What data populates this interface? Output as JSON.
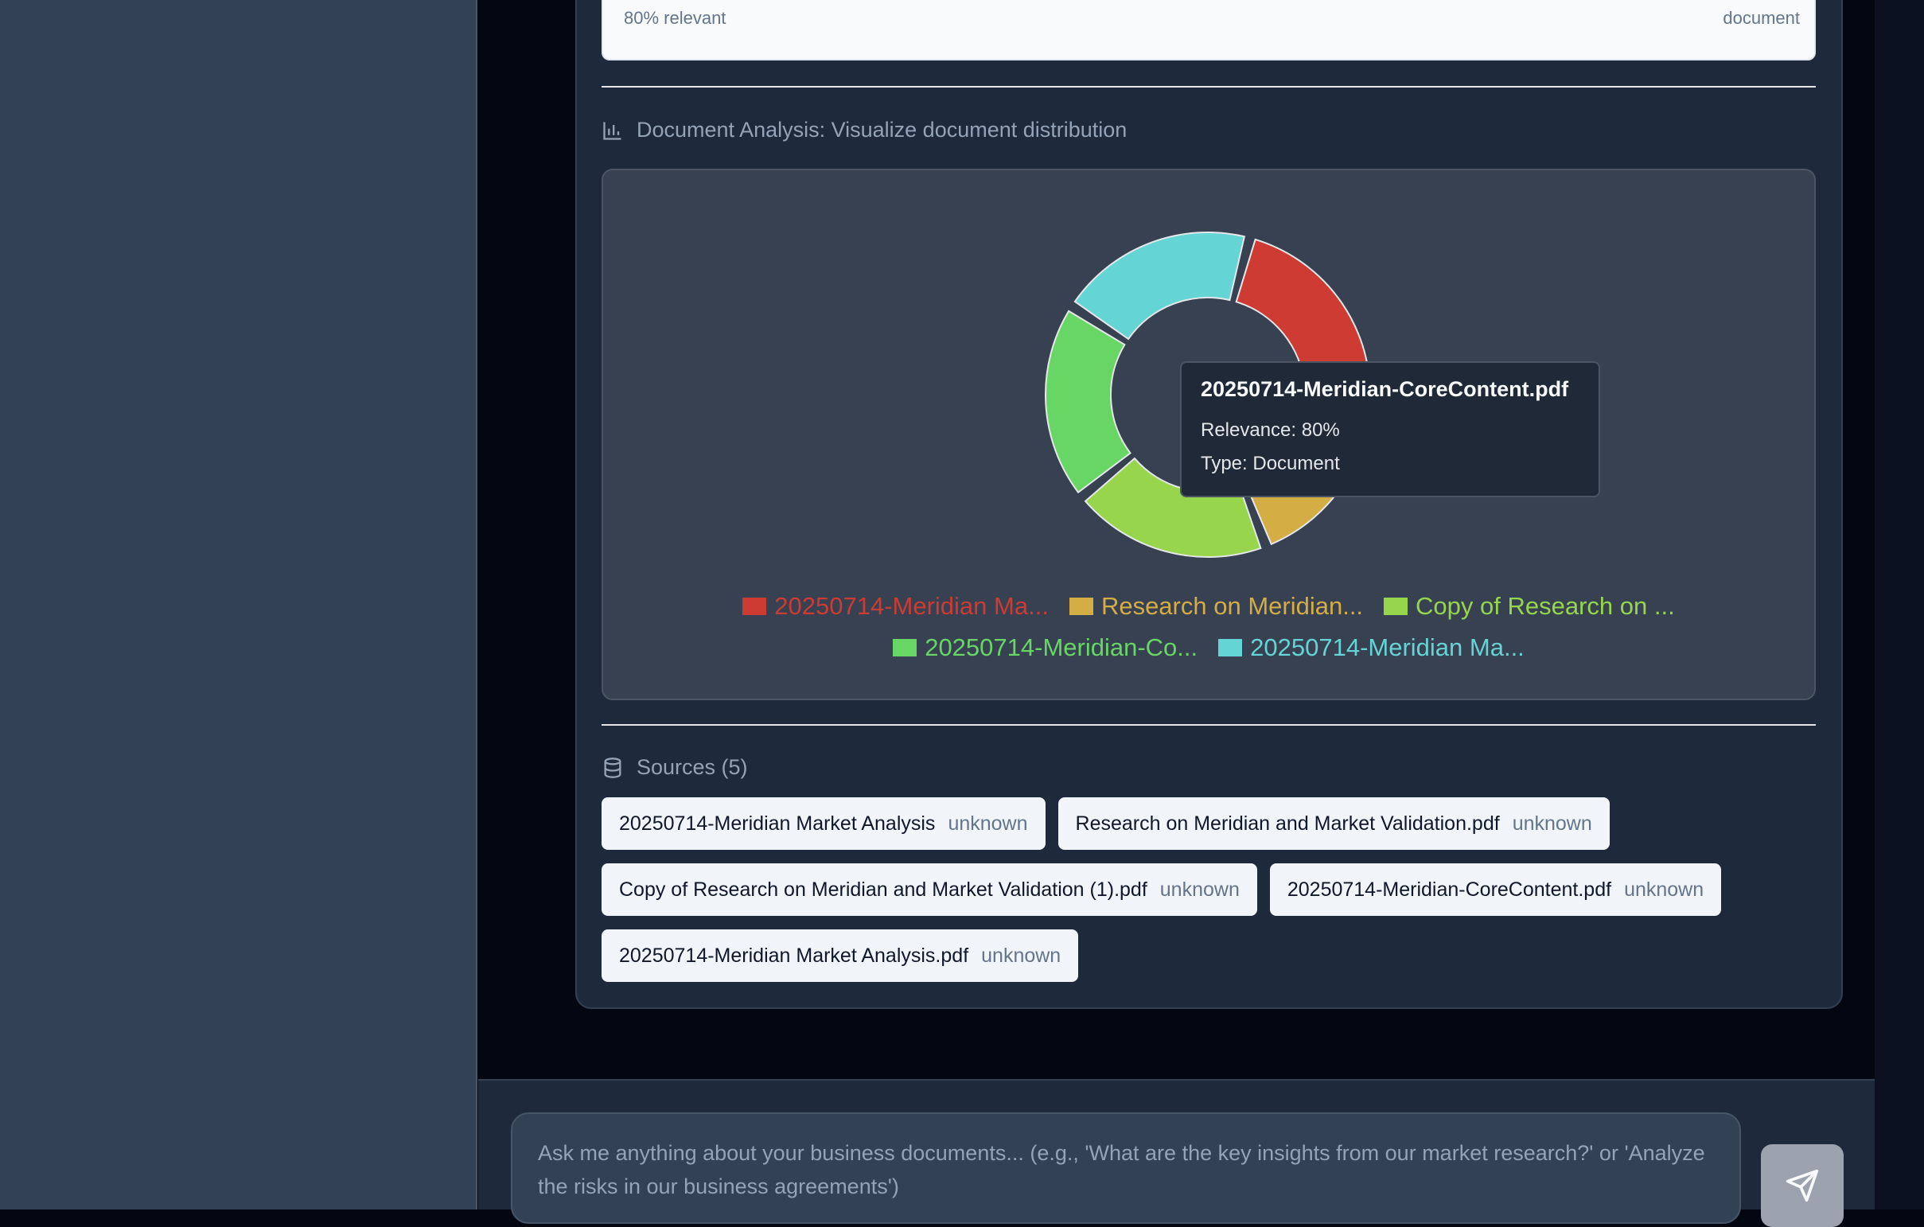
{
  "top_result": {
    "relevance_text": "80% relevant",
    "type_text": "document"
  },
  "analysis": {
    "title": "Document Analysis: Visualize document distribution",
    "icon": "bar-chart-icon"
  },
  "chart_data": {
    "type": "pie",
    "variant": "donut",
    "labels": [
      "20250714-Meridian Market Analysis",
      "Research on Meridian and Market Validation.pdf",
      "Copy of Research on Meridian and Market Validation (1).pdf",
      "20250714-Meridian-CoreContent.pdf",
      "20250714-Meridian Market Analysis.pdf"
    ],
    "legend_labels": [
      "20250714-Meridian Ma...",
      "Research on Meridian...",
      "Copy of Research on ...",
      "20250714-Meridian-Co...",
      "20250714-Meridian Ma..."
    ],
    "values": [
      80,
      80,
      80,
      80,
      80
    ],
    "colors": [
      "#cd3b33",
      "#d4ad45",
      "#97d64c",
      "#67d665",
      "#65d4d4"
    ],
    "legend_placement": "bottom",
    "tooltip": {
      "title": "20250714-Meridian-CoreContent.pdf",
      "line1": "Relevance: 80%",
      "line2": "Type: Document"
    }
  },
  "sources": {
    "title": "Sources (5)",
    "icon": "database-icon",
    "items": [
      {
        "name": "20250714-Meridian Market Analysis",
        "status": "unknown"
      },
      {
        "name": "Research on Meridian and Market Validation.pdf",
        "status": "unknown"
      },
      {
        "name": "Copy of Research on Meridian and Market Validation (1).pdf",
        "status": "unknown"
      },
      {
        "name": "20250714-Meridian-CoreContent.pdf",
        "status": "unknown"
      },
      {
        "name": "20250714-Meridian Market Analysis.pdf",
        "status": "unknown"
      }
    ]
  },
  "composer": {
    "placeholder": "Ask me anything about your business documents... (e.g., 'What are the key insights from our market research?' or 'Analyze the risks in our business agreements')",
    "send_icon": "send-icon"
  }
}
